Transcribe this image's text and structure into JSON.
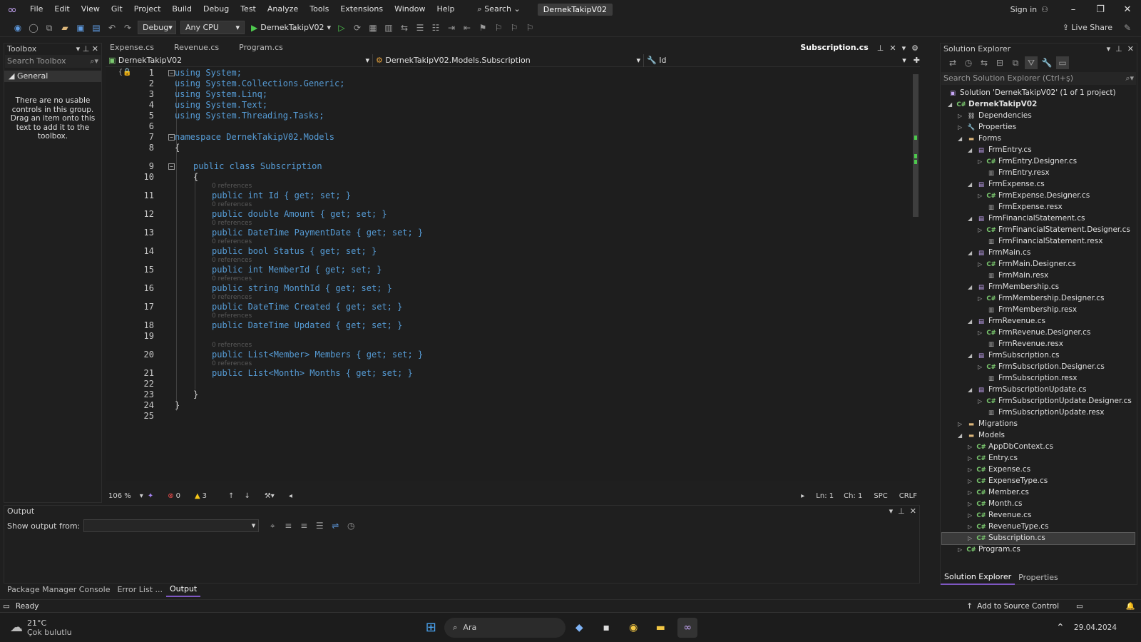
{
  "menu": {
    "items": [
      "File",
      "Edit",
      "View",
      "Git",
      "Project",
      "Build",
      "Debug",
      "Test",
      "Analyze",
      "Tools",
      "Extensions",
      "Window",
      "Help"
    ],
    "search_label": "Search",
    "solution_title": "DernekTakipV02",
    "sign_in": "Sign in",
    "live_share": "Live Share"
  },
  "toolbar": {
    "config": "Debug",
    "platform": "Any CPU",
    "start_target": "DernekTakipV02"
  },
  "toolbox": {
    "title": "Toolbox",
    "search_placeholder": "Search Toolbox",
    "group": "General",
    "empty_message": "There are no usable controls in this group. Drag an item onto this text to add it to the toolbox."
  },
  "editor_tabs": {
    "tabs": [
      "Expense.cs",
      "Revenue.cs",
      "Program.cs"
    ],
    "active": "Subscription.cs"
  },
  "navbar": {
    "project": "DernekTakipV02",
    "type": "DernekTakipV02.Models.Subscription",
    "member": "Id"
  },
  "code": {
    "refs_1": "0 references",
    "refs_2": "0 references",
    "lines": {
      "l1": "using System;",
      "l2": "using System.Collections.Generic;",
      "l3": "using System.Linq;",
      "l4": "using System.Text;",
      "l5": "using System.Threading.Tasks;",
      "l7": "namespace DernekTakipV02.Models",
      "l8": "{",
      "l9": "public class Subscription",
      "l10": "{",
      "l11": "public int Id { get; set; }",
      "l12": "public double Amount { get; set; }",
      "l13": "public DateTime PaymentDate { get; set; }",
      "l14": "public bool Status { get; set; }",
      "l15": "public int MemberId { get; set; }",
      "l16": "public string MonthId { get; set; }",
      "l17": "public DateTime Created { get; set; }",
      "l18": "public DateTime Updated { get; set; }",
      "l20": "public List<Member> Members { get; set; }",
      "l21": "public List<Month> Months { get; set; }",
      "l23": "}",
      "l24": "}"
    }
  },
  "editor_status": {
    "zoom": "106 %",
    "errors": "0",
    "warnings": "3",
    "ln": "Ln: 1",
    "ch": "Ch: 1",
    "spc": "SPC",
    "eol": "CRLF"
  },
  "output": {
    "title": "Output",
    "show_from_label": "Show output from:"
  },
  "bottom_tabs": [
    "Package Manager Console",
    "Error List ...",
    "Output"
  ],
  "solution_explorer": {
    "title": "Solution Explorer",
    "search_placeholder": "Search Solution Explorer (Ctrl+ş)",
    "solution": "Solution 'DernekTakipV02' (1 of 1 project)",
    "project": "DernekTakipV02",
    "items": {
      "dependencies": "Dependencies",
      "properties": "Properties",
      "forms": "Forms",
      "f1": "FrmEntry.cs",
      "f1d": "FrmEntry.Designer.cs",
      "f1r": "FrmEntry.resx",
      "f2": "FrmExpense.cs",
      "f2d": "FrmExpense.Designer.cs",
      "f2r": "FrmExpense.resx",
      "f3": "FrmFinancialStatement.cs",
      "f3d": "FrmFinancialStatement.Designer.cs",
      "f3r": "FrmFinancialStatement.resx",
      "f4": "FrmMain.cs",
      "f4d": "FrmMain.Designer.cs",
      "f4r": "FrmMain.resx",
      "f5": "FrmMembership.cs",
      "f5d": "FrmMembership.Designer.cs",
      "f5r": "FrmMembership.resx",
      "f6": "FrmRevenue.cs",
      "f6d": "FrmRevenue.Designer.cs",
      "f6r": "FrmRevenue.resx",
      "f7": "FrmSubscription.cs",
      "f7d": "FrmSubscription.Designer.cs",
      "f7r": "FrmSubscription.resx",
      "f8": "FrmSubscriptionUpdate.cs",
      "f8d": "FrmSubscriptionUpdate.Designer.cs",
      "f8r": "FrmSubscriptionUpdate.resx",
      "migrations": "Migrations",
      "models": "Models",
      "m1": "AppDbContext.cs",
      "m2": "Entry.cs",
      "m3": "Expense.cs",
      "m4": "ExpenseType.cs",
      "m5": "Member.cs",
      "m6": "Month.cs",
      "m7": "Revenue.cs",
      "m8": "RevenueType.cs",
      "m9": "Subscription.cs",
      "program": "Program.cs"
    },
    "tabs": [
      "Solution Explorer",
      "Properties"
    ]
  },
  "status": {
    "ready": "Ready",
    "source_control": "Add to Source Control"
  },
  "taskbar": {
    "weather_temp": "21°C",
    "weather_desc": "Çok bulutlu",
    "search": "Ara",
    "date": "29.04.2024"
  }
}
